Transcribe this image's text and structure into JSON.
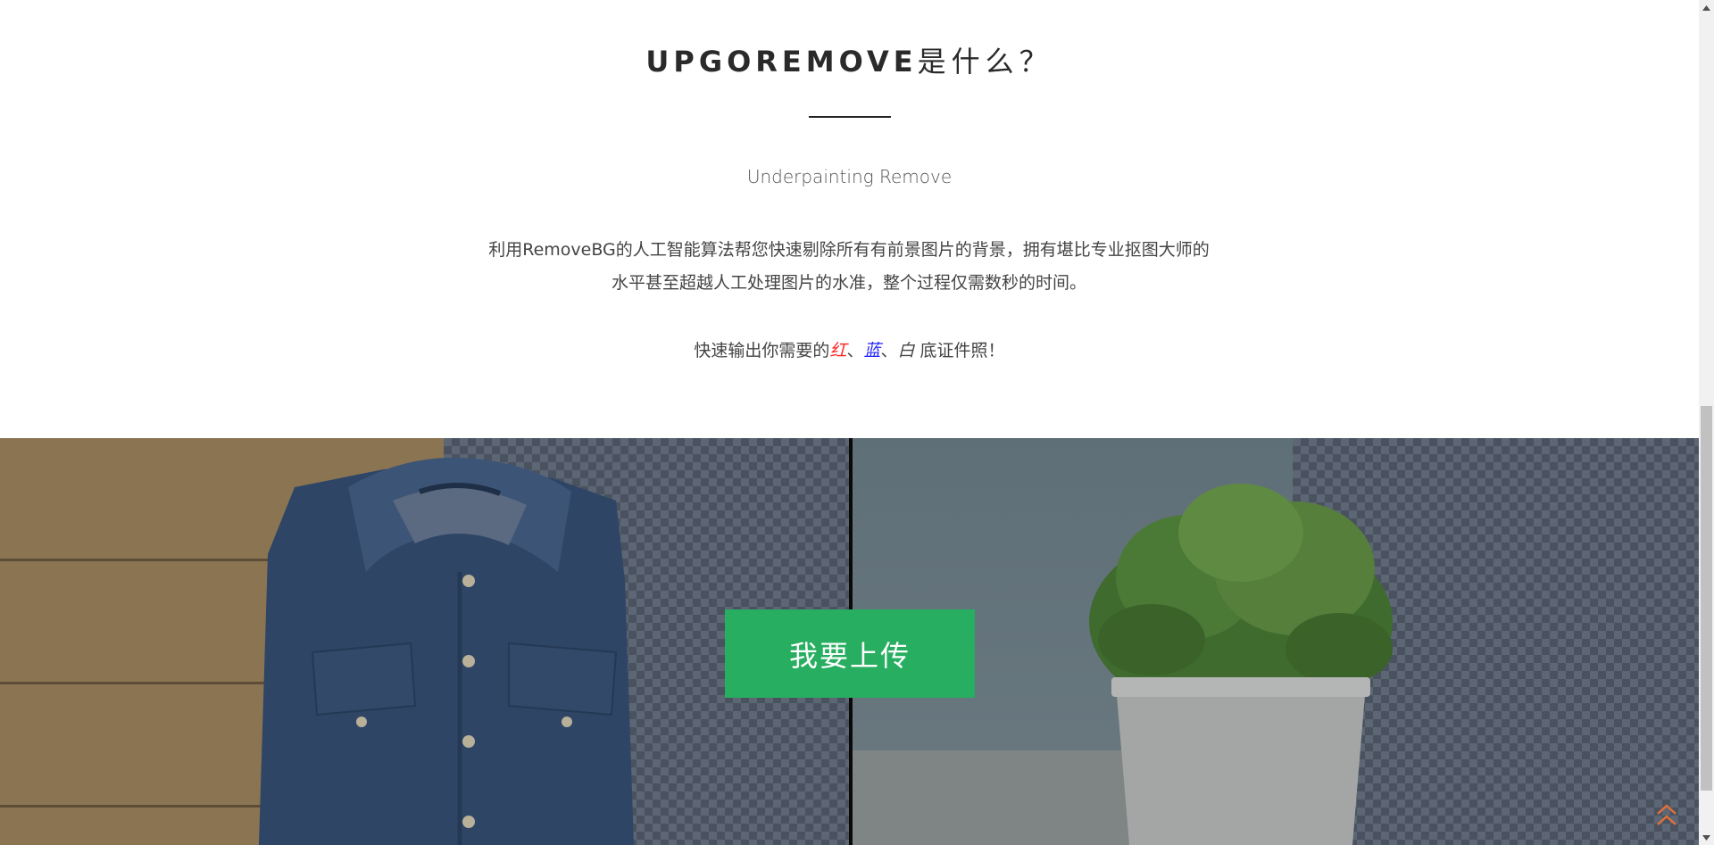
{
  "intro": {
    "heading_brand": "UPGOREMOVE",
    "heading_suffix": "是什么？",
    "subtitle": "Underpainting Remove",
    "description": "利用RemoveBG的人工智能算法帮您快速剔除所有有前景图片的背景，拥有堪比专业抠图大师的水平甚至超越人工处理图片的水准，整个过程仅需数秒的时间。",
    "tagline_prefix": "快速输出你需要的",
    "tagline_red": "红",
    "sep1": "、",
    "tagline_blue": "蓝",
    "sep2": "、",
    "tagline_white": "白",
    "tagline_suffix": " 底证件照！"
  },
  "hero": {
    "upload_button_label": "我要上传"
  },
  "colors": {
    "accent_green": "#27ae60",
    "red": "#ff2020",
    "blue": "#2020ff",
    "back_top_orange": "#e0703a"
  },
  "icons": {
    "back_to_top": "double-chevron-up-icon",
    "shirt": "denim-shirt-image",
    "plant": "potted-plant-image"
  }
}
